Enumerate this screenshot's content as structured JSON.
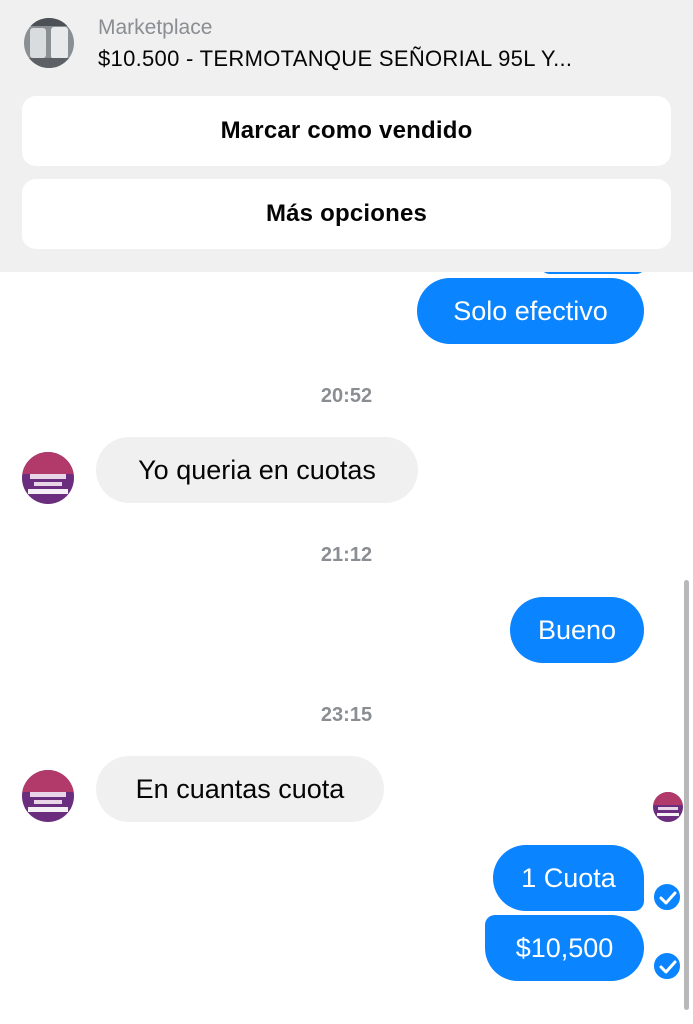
{
  "header": {
    "label": "Marketplace",
    "title": "$10.500 - TERMOTANQUE SEÑORIAL 95L Y...",
    "buttons": {
      "mark_sold": "Marcar como vendido",
      "more_options": "Más opciones"
    }
  },
  "conversation": {
    "messages": {
      "m1": "Solo efectivo",
      "m2": "Yo queria en cuotas",
      "m3": "Bueno",
      "m4": "En cuantas cuota",
      "m5": "1 Cuota",
      "m6": "$10,500"
    },
    "timestamps": {
      "t1": "20:52",
      "t2": "21:12",
      "t3": "23:15"
    }
  },
  "colors": {
    "outgoing_bubble": "#0a84ff",
    "incoming_bubble": "#f0f0f0",
    "header_bg": "#f0f0f0"
  },
  "icons": {
    "delivered": "check-circle-icon"
  }
}
